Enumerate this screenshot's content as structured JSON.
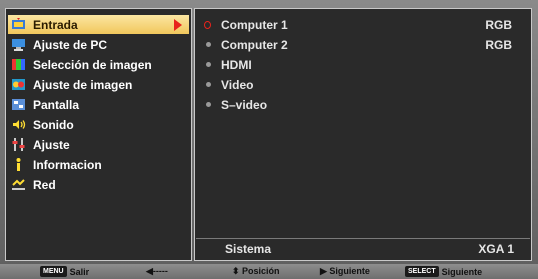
{
  "menu": {
    "items": [
      {
        "label": "Entrada",
        "icon": "input-icon"
      },
      {
        "label": "Ajuste de PC",
        "icon": "pc-adjust-icon"
      },
      {
        "label": "Selección de imagen",
        "icon": "image-select-icon"
      },
      {
        "label": "Ajuste de imagen",
        "icon": "image-adjust-icon"
      },
      {
        "label": "Pantalla",
        "icon": "screen-icon"
      },
      {
        "label": "Sonido",
        "icon": "sound-icon"
      },
      {
        "label": "Ajuste",
        "icon": "setting-icon"
      },
      {
        "label": "Informacion",
        "icon": "info-icon"
      },
      {
        "label": "Red",
        "icon": "network-icon"
      }
    ],
    "active_index": 0
  },
  "inputs": {
    "options": [
      {
        "label": "Computer 1",
        "value": "RGB",
        "selected": true
      },
      {
        "label": "Computer 2",
        "value": "RGB",
        "selected": false
      },
      {
        "label": "HDMI",
        "value": "",
        "selected": false
      },
      {
        "label": "Video",
        "value": "",
        "selected": false
      },
      {
        "label": "S–video",
        "value": "",
        "selected": false
      }
    ],
    "system_label": "Sistema",
    "system_value": "XGA 1"
  },
  "help": {
    "exit_key": "MENU",
    "exit_label": "Salir",
    "back_label": "◀-----",
    "position_label": "⬍ Posición",
    "next_label": "▶ Siguiente",
    "select_key": "SELECT",
    "select_label": "Siguiente"
  }
}
